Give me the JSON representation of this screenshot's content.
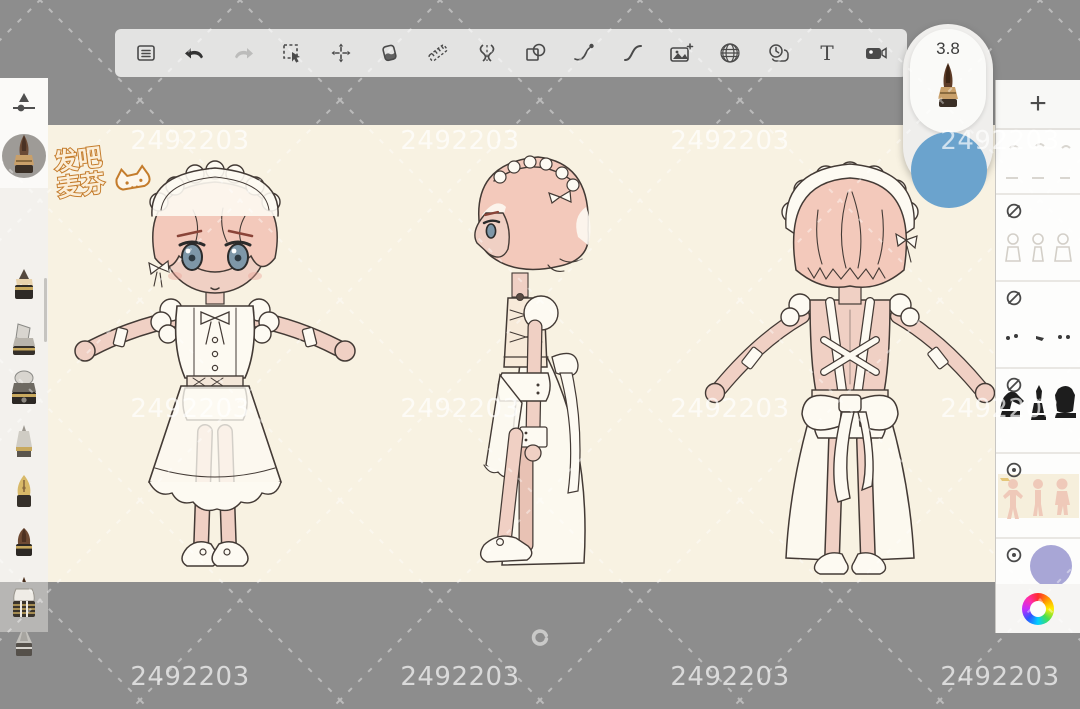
{
  "app": {
    "kind": "digital-painting-app"
  },
  "toolbar": {
    "tools": [
      {
        "name": "menu",
        "icon": "list-menu-icon"
      },
      {
        "name": "undo",
        "icon": "undo-arrow-icon"
      },
      {
        "name": "redo",
        "icon": "redo-arrow-icon"
      },
      {
        "name": "rect-select",
        "icon": "marquee-cursor-icon"
      },
      {
        "name": "transform-move",
        "icon": "four-way-arrows-icon"
      },
      {
        "name": "fill",
        "icon": "paint-bucket-icon"
      },
      {
        "name": "ruler",
        "icon": "diagonal-ruler-icon"
      },
      {
        "name": "liquify-symmetry",
        "icon": "s-curves-divider-icon"
      },
      {
        "name": "shape",
        "icon": "square-circle-icon"
      },
      {
        "name": "curve-pen",
        "icon": "curve-with-node-icon"
      },
      {
        "name": "curve",
        "icon": "s-curve-icon"
      },
      {
        "name": "import-image",
        "icon": "picture-plus-icon"
      },
      {
        "name": "perspective-grid",
        "icon": "wireframe-globe-icon"
      },
      {
        "name": "timelapse",
        "icon": "clock-frame-icon"
      },
      {
        "name": "text",
        "icon": "letter-t-icon"
      },
      {
        "name": "camera-export",
        "icon": "video-camera-icon"
      }
    ]
  },
  "brush": {
    "size_label": "3.8",
    "current_color_hex": "#6ba3cd",
    "tip": "sharp-brown-brush"
  },
  "sidebar": {
    "tools": [
      "brush-settings",
      "current-brush-sharp",
      "pencil",
      "chisel-marker",
      "airbrush-pen",
      "liner-pen",
      "fountain-nib-pen",
      "round-brush",
      "pointed-brush",
      "soft-gray-brush",
      "eraser"
    ]
  },
  "layers_panel": {
    "add_label": "+",
    "layers": [
      {
        "visibility": "none",
        "thumb": "faint-sketch",
        "h": 63
      },
      {
        "visibility": "hidden",
        "thumb": "faint-figures",
        "h": 85
      },
      {
        "visibility": "hidden",
        "thumb": "dark-marks",
        "h": 85
      },
      {
        "visibility": "hidden",
        "thumb": "black-silhouettes",
        "h": 83
      },
      {
        "visibility": "visible",
        "thumb": "color-bodies",
        "h": 83
      },
      {
        "visibility": "visible",
        "thumb": "purple-circle",
        "h": 55,
        "color_hex": "#a8a6d6"
      }
    ]
  },
  "canvas": {
    "bg_hex": "#f8f2e2",
    "logo_line1": "发吧",
    "logo_line2": "麦芬",
    "content": "maid-outfit character turnaround: front, side, back views"
  },
  "watermark": {
    "text": "2492203",
    "rows_y": [
      141,
      409,
      677
    ],
    "cols_x": [
      190,
      460,
      730,
      1000
    ]
  },
  "colors": {
    "background_gray": "#8d8d8d",
    "toolbar_bg": "#e3e3e2",
    "canvas_cream": "#f8f2e2",
    "skin": "#f0d0c4",
    "hair": "#f3c9bb",
    "accent_blue": "#6ba3cd",
    "layer_purple": "#a8a6d6"
  }
}
